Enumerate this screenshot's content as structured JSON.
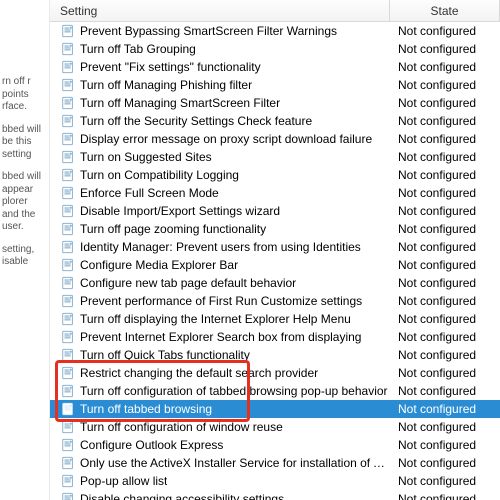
{
  "columns": {
    "setting": "Setting",
    "state": "State"
  },
  "sidebar": {
    "snippets": [
      "rn off r points rface.",
      "bbed will be this setting",
      "bbed will appear plorer and the user.",
      "setting, isable"
    ]
  },
  "default_state": "Not configured",
  "highlight_index": 19,
  "settings": [
    {
      "label": "Prevent Bypassing SmartScreen Filter Warnings"
    },
    {
      "label": "Turn off Tab Grouping"
    },
    {
      "label": "Prevent \"Fix settings\" functionality"
    },
    {
      "label": "Turn off Managing Phishing filter"
    },
    {
      "label": "Turn off Managing SmartScreen Filter"
    },
    {
      "label": "Turn off the Security Settings Check feature"
    },
    {
      "label": "Display error message on proxy script download failure"
    },
    {
      "label": "Turn on Suggested Sites"
    },
    {
      "label": "Turn on Compatibility Logging"
    },
    {
      "label": "Enforce Full Screen Mode"
    },
    {
      "label": "Disable Import/Export Settings wizard"
    },
    {
      "label": "Turn off page zooming functionality"
    },
    {
      "label": "Identity Manager: Prevent users from using Identities"
    },
    {
      "label": "Configure Media Explorer Bar"
    },
    {
      "label": "Configure new tab page default behavior"
    },
    {
      "label": "Prevent performance of First Run Customize settings"
    },
    {
      "label": "Turn off displaying the Internet Explorer Help Menu"
    },
    {
      "label": "Prevent Internet Explorer Search box from displaying"
    },
    {
      "label": "Turn off Quick Tabs functionality"
    },
    {
      "label": "Restrict changing the default search provider"
    },
    {
      "label": "Turn off configuration of tabbed browsing pop-up behavior"
    },
    {
      "label": "Turn off tabbed browsing",
      "selected": true
    },
    {
      "label": "Turn off configuration of window reuse"
    },
    {
      "label": "Configure Outlook Express"
    },
    {
      "label": "Only use the ActiveX Installer Service for installation of Activ..."
    },
    {
      "label": "Pop-up allow list"
    },
    {
      "label": "Disable changing accessibility settings"
    }
  ]
}
